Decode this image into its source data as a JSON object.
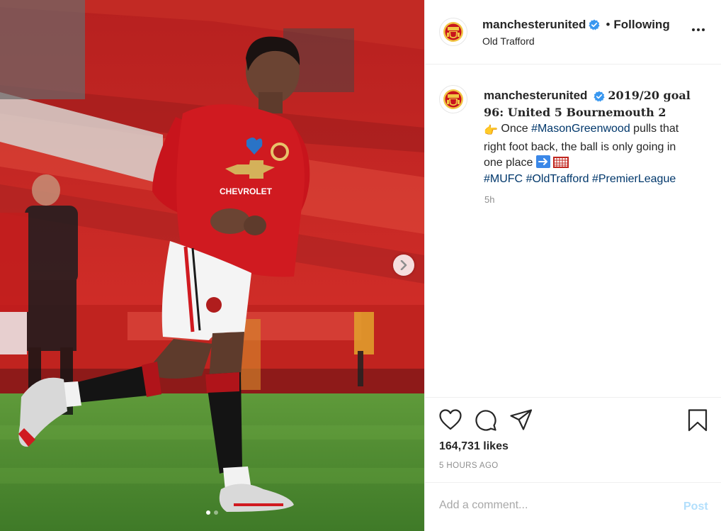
{
  "post": {
    "username": "manchesterunited",
    "follow_separator": "•",
    "follow_label": "Following",
    "location": "Old Trafford",
    "slide_count": 2,
    "current_slide": 1
  },
  "caption": {
    "username": "manchesterunited",
    "title_line": "2019/20 goal 96: United 5 Bournemouth 2",
    "pointer_emoji": "👉",
    "text_before_tag": "Once",
    "tag_player": "#MasonGreenwood",
    "text_after_tag": "pulls that right foot back, the ball is only going in one place",
    "tags": [
      "#MUFC",
      "#OldTrafford",
      "#PremierLeague"
    ],
    "time_short": "5h"
  },
  "engagement": {
    "likes": "164,731 likes",
    "time_ago": "5 HOURS AGO"
  },
  "comment": {
    "placeholder": "Add a comment...",
    "post_label": "Post"
  },
  "colors": {
    "verified": "#3897f0",
    "hashtag": "#00376b",
    "kit_red": "#d01a20",
    "post_disabled": "#b2dffc"
  },
  "icons": [
    "verified-badge-icon",
    "more-options-icon",
    "chevron-right-icon",
    "heart-icon",
    "comment-icon",
    "share-icon",
    "bookmark-icon",
    "club-crest-icon"
  ]
}
